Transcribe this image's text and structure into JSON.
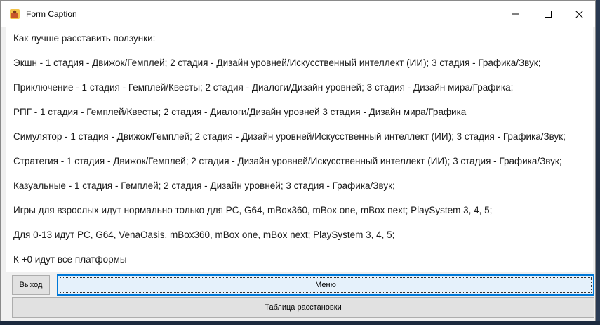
{
  "window": {
    "title": "Form Caption",
    "controls": {
      "minimize_icon": "minimize-icon",
      "maximize_icon": "maximize-icon",
      "close_icon": "close-icon"
    }
  },
  "content": {
    "lines": [
      "Как лучше расставить ползунки:",
      "Экшн - 1 стадия - Движок/Гемплей; 2 стадия - Дизайн уровней/Искусственный интеллект (ИИ); 3 стадия - Графика/Звук;",
      "Приключение - 1 стадия - Гемплей/Квесты; 2 стадия - Диалоги/Дизайн уровней; 3 стадия - Дизайн мира/Графика;",
      "РПГ - 1 стадия - Гемплей/Квесты; 2 стадия - Диалоги/Дизайн уровней 3 стадия - Дизайн мира/Графика",
      "Симулятор - 1 стадия - Движок/Гемплей; 2 стадия - Дизайн уровней/Искусственный интеллект (ИИ); 3 стадия - Графика/Звук;",
      "Стратегия - 1 стадия - Движок/Гемплей; 2 стадия - Дизайн уровней/Искусственный интеллект (ИИ); 3 стадия - Графика/Звук;",
      "Казуальные - 1 стадия - Гемплей; 2 стадия - Дизайн уровней; 3 стадия - Графика/Звук;",
      "Игры для взрослых идут нормально только для PC, G64, mBox360, mBox one, mBox next; PlaySystem 3, 4, 5;",
      "Для 0-13 идут PC, G64, VenaOasis, mBox360, mBox one, mBox next; PlaySystem 3, 4, 5;",
      "К +0 идут все платформы"
    ]
  },
  "buttons": {
    "exit_label": "Выход",
    "menu_label": "Меню",
    "table_label": "Таблица расстановки"
  },
  "colors": {
    "focus_border": "#0078d7",
    "button_face": "#e1e1e1",
    "content_background": "#ffffff"
  }
}
